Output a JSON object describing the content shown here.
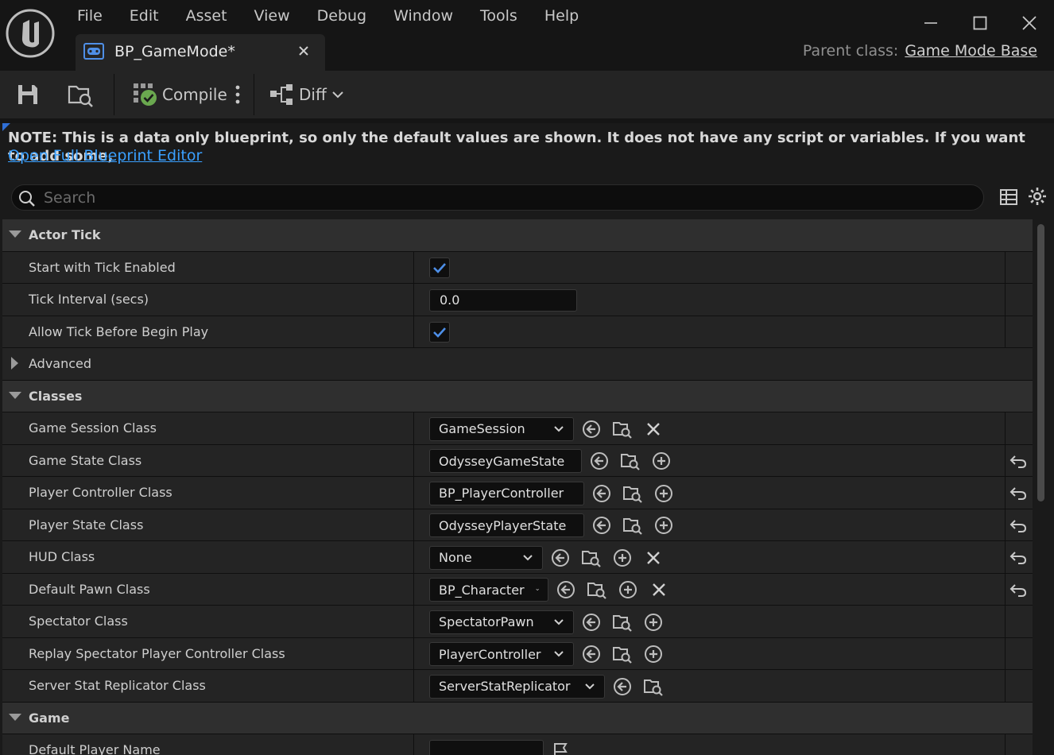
{
  "menu": [
    "File",
    "Edit",
    "Asset",
    "View",
    "Debug",
    "Window",
    "Tools",
    "Help"
  ],
  "tab": {
    "title": "BP_GameMode*"
  },
  "parent_class": {
    "label": "Parent class:",
    "value": "Game Mode Base"
  },
  "toolbar": {
    "compile_label": "Compile",
    "diff_label": "Diff"
  },
  "note": {
    "text": "NOTE: This is a data only blueprint, so only the default values are shown.  It does not have any script or variables.  If you want to add some,",
    "link": "Open Full Blueprint Editor"
  },
  "search": {
    "placeholder": "Search"
  },
  "details": {
    "actor_tick": {
      "label": "Actor Tick",
      "start_with_tick_enabled": "Start with Tick Enabled",
      "tick_interval": "Tick Interval (secs)",
      "tick_interval_value": "0.0",
      "allow_tick_before_begin_play": "Allow Tick Before Begin Play",
      "advanced": "Advanced"
    },
    "classes": {
      "label": "Classes",
      "game_session": {
        "label": "Game Session Class",
        "value": "GameSession"
      },
      "game_state": {
        "label": "Game State Class",
        "value": "OdysseyGameState"
      },
      "player_controller": {
        "label": "Player Controller Class",
        "value": "BP_PlayerController"
      },
      "player_state": {
        "label": "Player State Class",
        "value": "OdysseyPlayerState"
      },
      "hud": {
        "label": "HUD Class",
        "value": "None"
      },
      "default_pawn": {
        "label": "Default Pawn Class",
        "value": "BP_Character"
      },
      "spectator": {
        "label": "Spectator Class",
        "value": "SpectatorPawn"
      },
      "replay_spectator": {
        "label": "Replay Spectator Player Controller Class",
        "value": "PlayerController"
      },
      "server_stat": {
        "label": "Server Stat Replicator Class",
        "value": "ServerStatReplicator"
      }
    },
    "game": {
      "label": "Game",
      "default_player_name": "Default Player Name"
    }
  }
}
